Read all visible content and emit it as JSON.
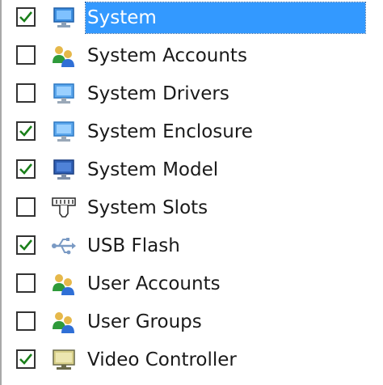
{
  "tree": {
    "items": [
      {
        "label": "System",
        "checked": true,
        "icon": "monitor-icon",
        "selected": true
      },
      {
        "label": "System Accounts",
        "checked": false,
        "icon": "users-icon"
      },
      {
        "label": "System Drivers",
        "checked": false,
        "icon": "monitor-icon"
      },
      {
        "label": "System Enclosure",
        "checked": true,
        "icon": "monitor-icon"
      },
      {
        "label": "System Model",
        "checked": true,
        "icon": "monitor-dark-icon"
      },
      {
        "label": "System Slots",
        "checked": false,
        "icon": "slot-icon"
      },
      {
        "label": "USB Flash",
        "checked": true,
        "icon": "usb-icon"
      },
      {
        "label": "User Accounts",
        "checked": false,
        "icon": "users-icon"
      },
      {
        "label": "User Groups",
        "checked": false,
        "icon": "users-icon"
      },
      {
        "label": "Video Controller",
        "checked": true,
        "icon": "display-icon"
      }
    ]
  },
  "colors": {
    "selection": "#3399ff",
    "check": "#1a7f1a"
  }
}
